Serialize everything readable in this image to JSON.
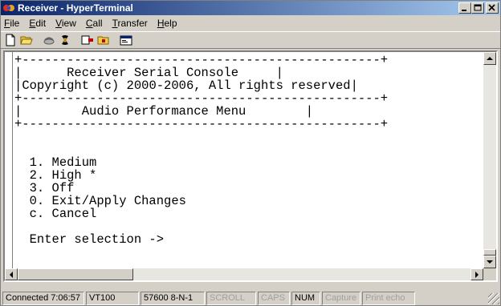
{
  "window": {
    "title": "Receiver - HyperTerminal",
    "controls": [
      "minimize",
      "maximize",
      "close"
    ]
  },
  "menu": [
    {
      "label": "File",
      "accel": "F",
      "rest": "ile"
    },
    {
      "label": "Edit",
      "accel": "E",
      "rest": "dit"
    },
    {
      "label": "View",
      "accel": "V",
      "rest": "iew"
    },
    {
      "label": "Call",
      "accel": "C",
      "rest": "all"
    },
    {
      "label": "Transfer",
      "accel": "T",
      "rest": "ransfer"
    },
    {
      "label": "Help",
      "accel": "H",
      "rest": "elp"
    }
  ],
  "toolbar": {
    "buttons": [
      "new-icon",
      "open-icon",
      "call-icon",
      "disconnect-icon",
      "send-icon",
      "receive-icon",
      "properties-icon"
    ]
  },
  "console": {
    "border_top": "+------------------------------------------------+",
    "title": "Receiver Serial Console",
    "copyright": "Copyright (c) 2000-2006, All rights reserved",
    "border_mid": "+------------------------------------------------+",
    "menu_title": "Audio Performance Menu",
    "border_bottom": "+------------------------------------------------+",
    "options": [
      "1. Medium",
      "2. High *",
      "3. Off",
      "0. Exit/Apply Changes",
      "c. Cancel"
    ],
    "prompt": "Enter selection ->"
  },
  "status": {
    "connected": "Connected 7:06:57",
    "emulation": "VT100",
    "port": "57600 8-N-1",
    "scroll": "SCROLL",
    "caps": "CAPS",
    "num": "NUM",
    "capture": "Capture",
    "print_echo": "Print echo"
  },
  "colors": {
    "title_start": "#0a246a",
    "title_end": "#a6caf0",
    "chrome": "#d4d0c8",
    "terminal_bg": "#ffffff",
    "terminal_fg": "#000000"
  }
}
